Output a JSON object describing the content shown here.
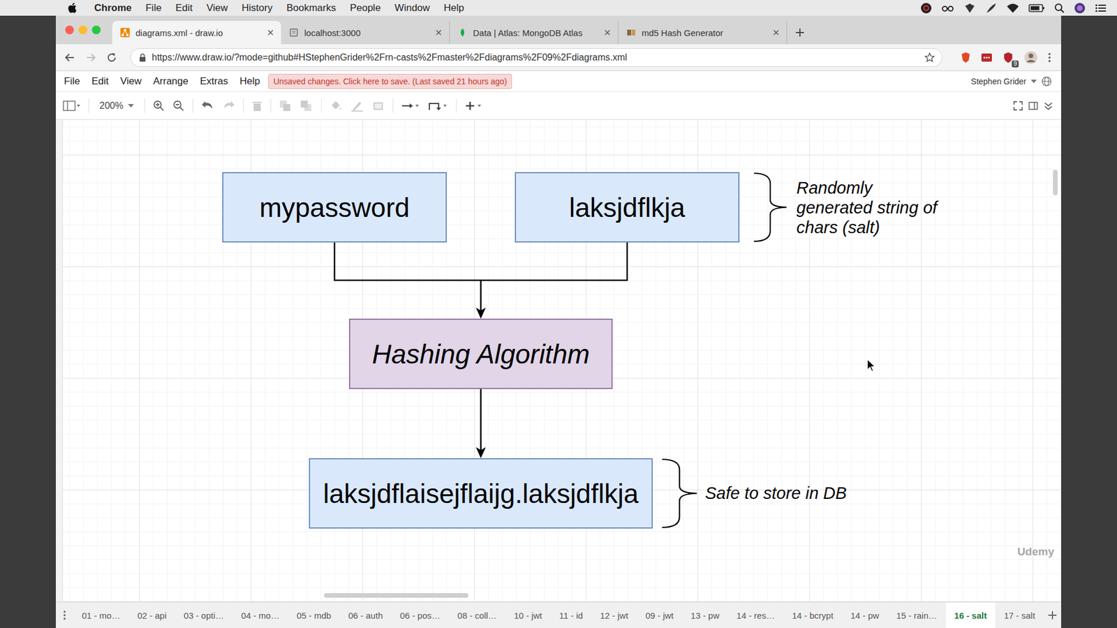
{
  "menubar": {
    "app": "Chrome",
    "items": [
      "File",
      "Edit",
      "View",
      "History",
      "Bookmarks",
      "People",
      "Window",
      "Help"
    ]
  },
  "browser": {
    "tabs": [
      {
        "label": "diagrams.xml - draw.io",
        "selected": true
      },
      {
        "label": "localhost:3000",
        "selected": false
      },
      {
        "label": "Data | Atlas: MongoDB Atlas",
        "selected": false
      },
      {
        "label": "md5 Hash Generator",
        "selected": false
      }
    ],
    "url": "https://www.draw.io/?mode=github#HStephenGrider%2Frn-casts%2Fmaster%2Fdiagrams%2F09%2Fdiagrams.xml",
    "extension_badge": "9"
  },
  "editor": {
    "menu": [
      "File",
      "Edit",
      "View",
      "Arrange",
      "Extras",
      "Help"
    ],
    "notice": "Unsaved changes. Click here to save. (Last saved 21 hours ago)",
    "user": "Stephen Grider",
    "zoom": "200%"
  },
  "diagram": {
    "nodes": [
      {
        "label": "mypassword",
        "kind": "input"
      },
      {
        "label": "laksjdflkja",
        "kind": "input"
      },
      {
        "label": "Hashing Algorithm",
        "kind": "process"
      },
      {
        "label": "laksjdflaisejflaijg.laksjdflkja",
        "kind": "output"
      }
    ],
    "annotations": [
      "Randomly generated string of chars (salt)",
      "Safe to store in DB"
    ]
  },
  "pages": [
    {
      "label": "01 - mo…",
      "selected": false
    },
    {
      "label": "02 - api",
      "selected": false
    },
    {
      "label": "03 - opti…",
      "selected": false
    },
    {
      "label": "04 - mo…",
      "selected": false
    },
    {
      "label": "05 - mdb",
      "selected": false
    },
    {
      "label": "06 - auth",
      "selected": false
    },
    {
      "label": "06 - pos…",
      "selected": false
    },
    {
      "label": "08 - coll…",
      "selected": false
    },
    {
      "label": "10 - jwt",
      "selected": false
    },
    {
      "label": "11 - id",
      "selected": false
    },
    {
      "label": "12 - jwt",
      "selected": false
    },
    {
      "label": "09 - jwt",
      "selected": false
    },
    {
      "label": "13 - pw",
      "selected": false
    },
    {
      "label": "14 - res…",
      "selected": false
    },
    {
      "label": "14 - bcrypt",
      "selected": false
    },
    {
      "label": "14 - pw",
      "selected": false
    },
    {
      "label": "15 - rain…",
      "selected": false
    },
    {
      "label": "16 - salt",
      "selected": true
    },
    {
      "label": "17 - salt",
      "selected": false
    }
  ],
  "watermark": "Udemy"
}
